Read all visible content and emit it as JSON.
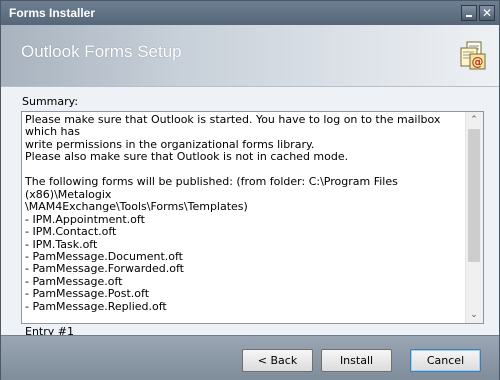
{
  "window": {
    "title": "Forms Installer"
  },
  "header": {
    "title": "Outlook Forms Setup",
    "icon": "outlook-forms-icon"
  },
  "summary": {
    "label": "Summary:",
    "text": "Please make sure that Outlook is started. You have to log on to the mailbox which has\nwrite permissions in the organizational forms library.\nPlease also make sure that Outlook is not in cached mode.\n\nThe following forms will be published: (from folder: C:\\Program Files (x86)\\Metalogix\n\\MAM4Exchange\\Tools\\Forms\\Templates)\n- IPM.Appointment.oft\n- IPM.Contact.oft\n- IPM.Task.oft\n- PamMessage.Document.oft\n- PamMessage.Forwarded.oft\n- PamMessage.oft\n- PamMessage.Post.oft\n- PamMessage.Replied.oft\n\nEntry #1"
  },
  "buttons": {
    "back": "< Back",
    "install": "Install",
    "cancel": "Cancel"
  },
  "colors": {
    "titlebar": "#5f6f82",
    "footer": "#8995a3",
    "default_button_border": "#3c7fb1"
  }
}
